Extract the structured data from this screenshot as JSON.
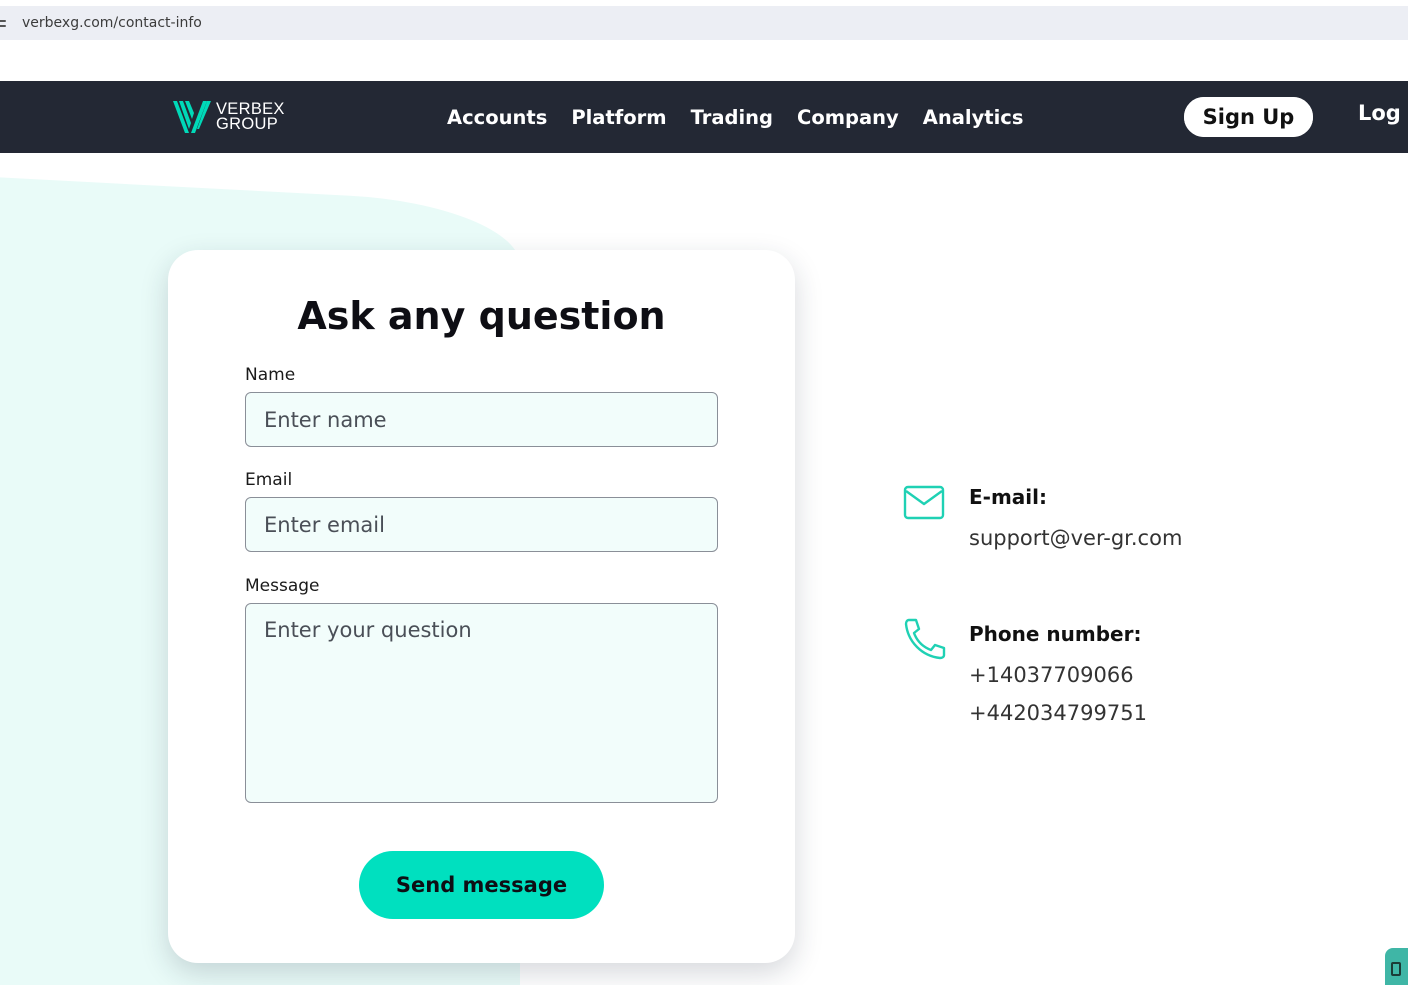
{
  "browser": {
    "url": "verbexg.com/contact-info"
  },
  "nav": {
    "logo_line1": "VERBEX",
    "logo_line2": "GROUP",
    "links": [
      "Accounts",
      "Platform",
      "Trading",
      "Company",
      "Analytics"
    ],
    "signup_label": "Sign Up",
    "login_label": "Log"
  },
  "form": {
    "title": "Ask any question",
    "name_label": "Name",
    "name_placeholder": "Enter name",
    "email_label": "Email",
    "email_placeholder": "Enter email",
    "message_label": "Message",
    "message_placeholder": "Enter your question",
    "submit_label": "Send message"
  },
  "contact": {
    "email_heading": "E-mail:",
    "email_value": "support@ver-gr.com",
    "phone_heading": "Phone number:",
    "phone_1": "+14037709066",
    "phone_2": "+442034799751"
  },
  "colors": {
    "accent": "#00e0bf",
    "nav_bg": "#232834",
    "card_bg": "#ffffff",
    "decor_bg": "#e9fbf8"
  }
}
